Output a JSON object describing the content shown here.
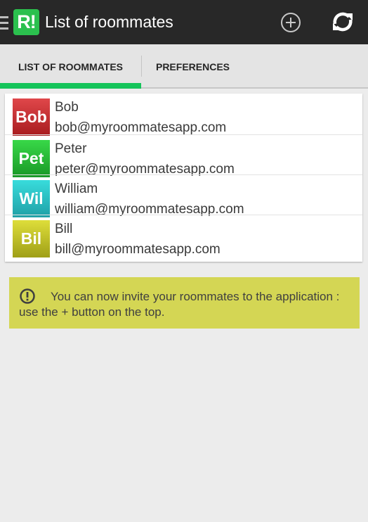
{
  "app": {
    "logo_text": "R!",
    "title": "List of roommates",
    "actions": {
      "add_icon": "add-circle-icon",
      "refresh_icon": "refresh-icon"
    }
  },
  "tabs": [
    {
      "label": "LIST OF ROOMMATES",
      "selected": true
    },
    {
      "label": "PREFERENCES",
      "selected": false
    }
  ],
  "roommates": [
    {
      "initials": "Bob",
      "name": "Bob",
      "email": "bob@myroommatesapp.com",
      "color_top": "#e0474a",
      "color_bottom": "#a81c1f"
    },
    {
      "initials": "Pet",
      "name": "Peter",
      "email": "peter@myroommatesapp.com",
      "color_top": "#38d848",
      "color_bottom": "#199826"
    },
    {
      "initials": "Wil",
      "name": "William",
      "email": "william@myroommatesapp.com",
      "color_top": "#38dcdc",
      "color_bottom": "#1fa0a6"
    },
    {
      "initials": "Bil",
      "name": "Bill",
      "email": "bill@myroommatesapp.com",
      "color_top": "#dede3a",
      "color_bottom": "#9f9f17"
    }
  ],
  "info": {
    "icon": "alert-circle-icon",
    "text": "You can now invite your roommates to the application : use the + button on the top."
  },
  "colors": {
    "action_bar": "#282828",
    "accent": "#15c45a",
    "logo": "#2bc04e",
    "banner": "#d4d654"
  }
}
